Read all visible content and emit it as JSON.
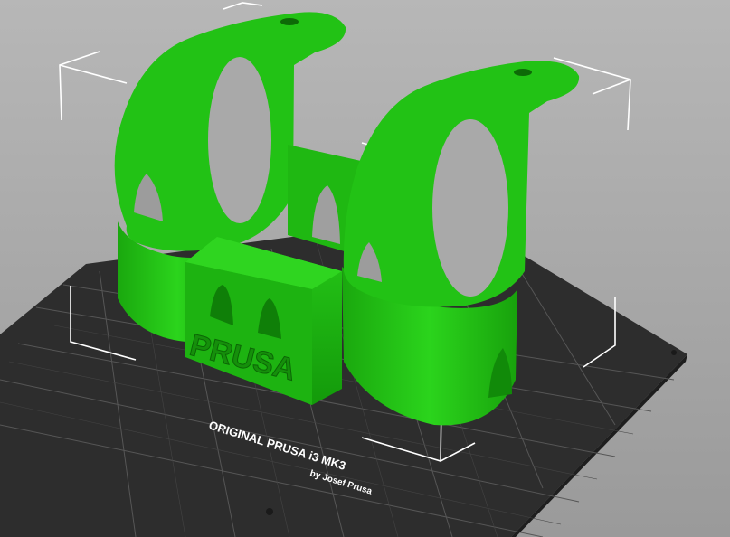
{
  "viewport": {
    "background_top": "#b7b7b7",
    "background_bottom": "#9a9a9a"
  },
  "print_bed": {
    "brand_line": "ORIGINAL PRUSA i3 MK3",
    "byline": "by Josef Prusa",
    "bed_color": "#2d2d2d",
    "grid_color": "#5a5a5a"
  },
  "model": {
    "emboss_text": "PRUSA",
    "color": "#21c016",
    "selected": true
  },
  "selection_box": {
    "color": "#ffffff"
  }
}
